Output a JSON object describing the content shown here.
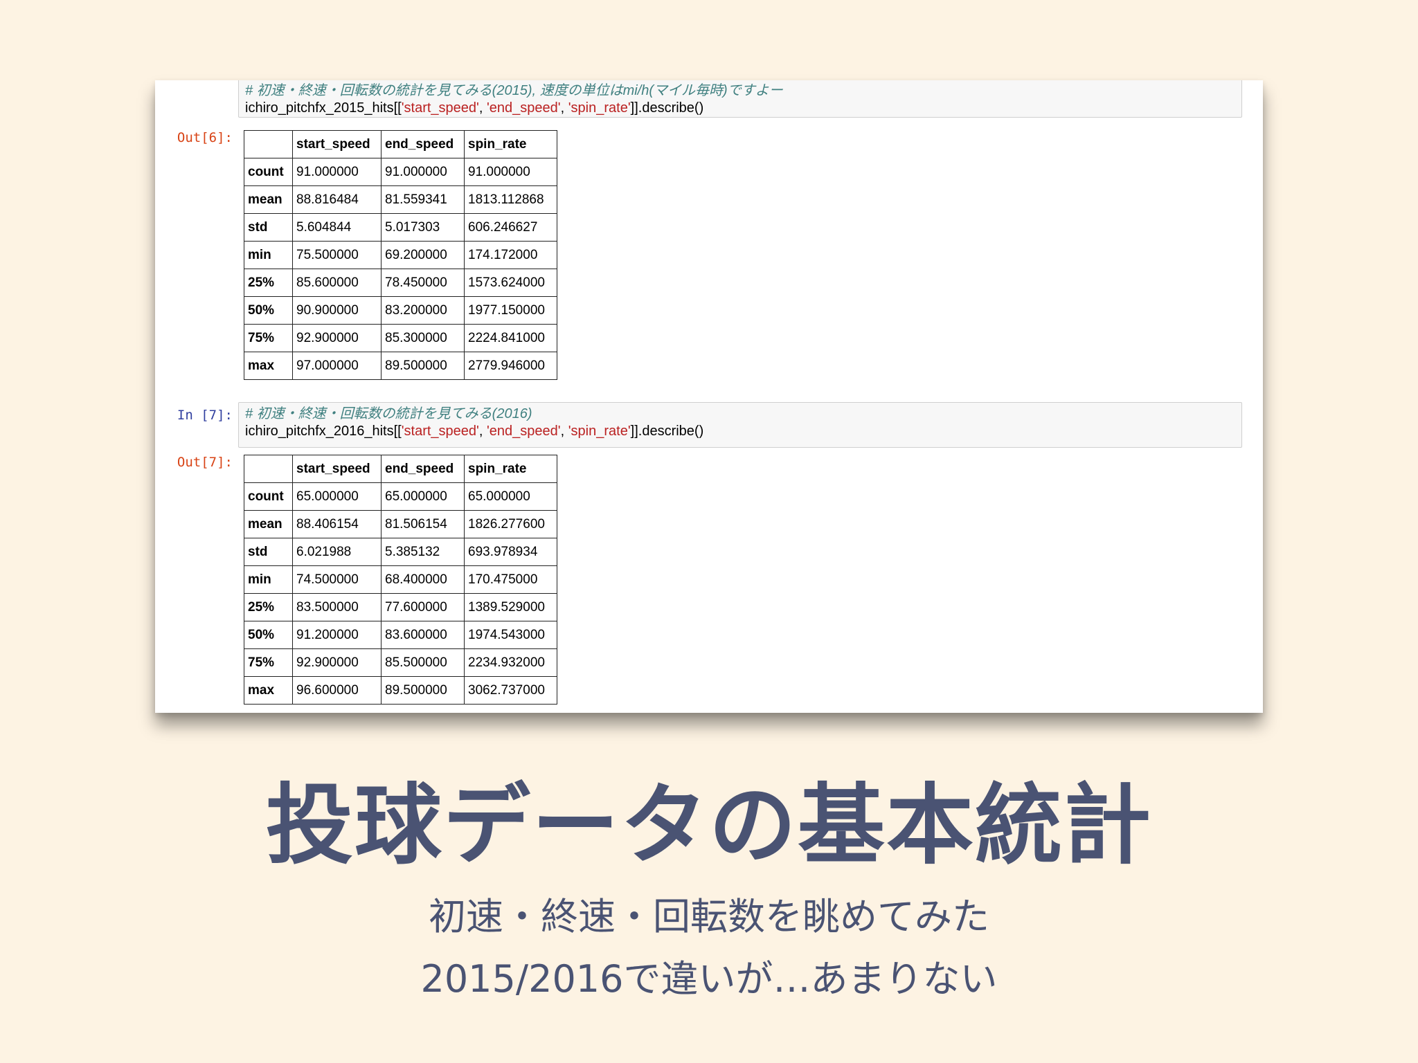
{
  "cells": [
    {
      "in_prompt": "",
      "comment": "# 初速・終速・回転数の統計を見てみる(2015), 速度の単位はmi/h(マイル毎時)ですよー",
      "code_prefix": "ichiro_pitchfx_2015_hits[[",
      "code_s1": "'start_speed'",
      "code_sep1": ", ",
      "code_s2": "'end_speed'",
      "code_sep2": ", ",
      "code_s3": "'spin_rate'",
      "code_suffix": "]].describe()",
      "out_prompt": "Out[6]:",
      "table": {
        "columns": [
          "",
          "start_speed",
          "end_speed",
          "spin_rate"
        ],
        "rows": [
          [
            "count",
            "91.000000",
            "91.000000",
            "91.000000"
          ],
          [
            "mean",
            "88.816484",
            "81.559341",
            "1813.112868"
          ],
          [
            "std",
            "5.604844",
            "5.017303",
            "606.246627"
          ],
          [
            "min",
            "75.500000",
            "69.200000",
            "174.172000"
          ],
          [
            "25%",
            "85.600000",
            "78.450000",
            "1573.624000"
          ],
          [
            "50%",
            "90.900000",
            "83.200000",
            "1977.150000"
          ],
          [
            "75%",
            "92.900000",
            "85.300000",
            "2224.841000"
          ],
          [
            "max",
            "97.000000",
            "89.500000",
            "2779.946000"
          ]
        ]
      }
    },
    {
      "in_prompt": "In [7]:",
      "comment": "# 初速・終速・回転数の統計を見てみる(2016)",
      "code_prefix": "ichiro_pitchfx_2016_hits[[",
      "code_s1": "'start_speed'",
      "code_sep1": ", ",
      "code_s2": "'end_speed'",
      "code_sep2": ", ",
      "code_s3": "'spin_rate'",
      "code_suffix": "]].describe()",
      "out_prompt": "Out[7]:",
      "table": {
        "columns": [
          "",
          "start_speed",
          "end_speed",
          "spin_rate"
        ],
        "rows": [
          [
            "count",
            "65.000000",
            "65.000000",
            "65.000000"
          ],
          [
            "mean",
            "88.406154",
            "81.506154",
            "1826.277600"
          ],
          [
            "std",
            "6.021988",
            "5.385132",
            "693.978934"
          ],
          [
            "min",
            "74.500000",
            "68.400000",
            "170.475000"
          ],
          [
            "25%",
            "83.500000",
            "77.600000",
            "1389.529000"
          ],
          [
            "50%",
            "91.200000",
            "83.600000",
            "1974.543000"
          ],
          [
            "75%",
            "92.900000",
            "85.500000",
            "2234.932000"
          ],
          [
            "max",
            "96.600000",
            "89.500000",
            "3062.737000"
          ]
        ]
      }
    }
  ],
  "slide": {
    "title": "投球データの基本統計",
    "subtitle_line1": "初速・終速・回転数を眺めてみた",
    "subtitle_line2": "2015/2016で違いが…あまりない"
  },
  "colors": {
    "background": "#fdf3e3",
    "title_text": "#4a5373",
    "in_prompt": "#303f9f",
    "out_prompt": "#d84315",
    "comment": "#408080",
    "string": "#ba2121"
  }
}
